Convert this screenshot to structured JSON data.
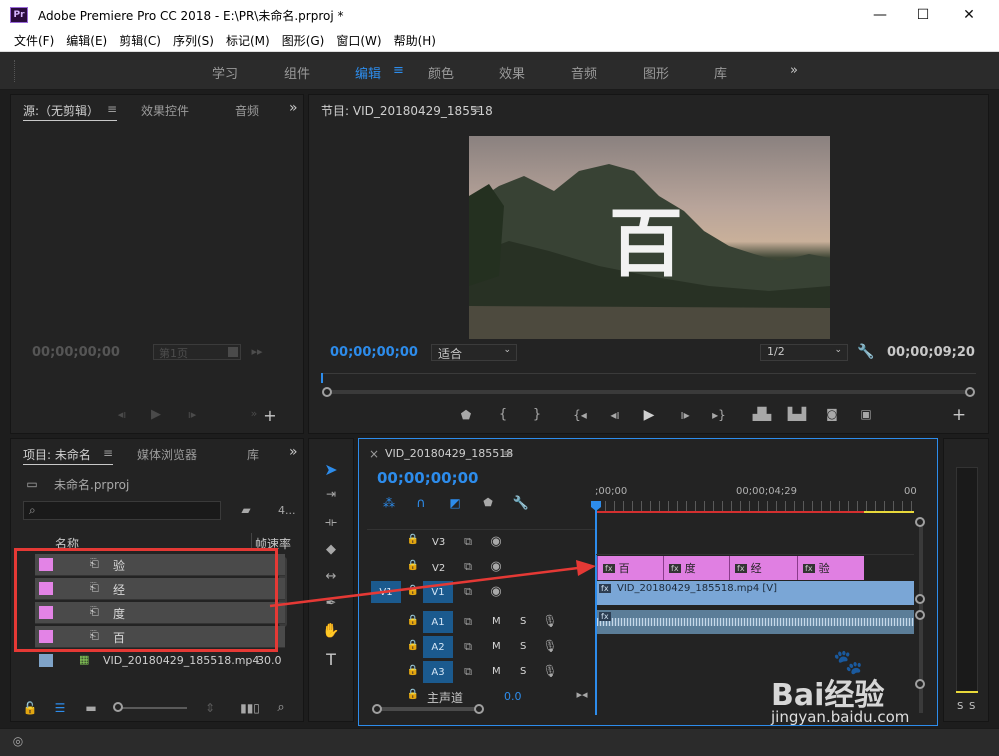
{
  "window": {
    "title": "Adobe Premiere Pro CC 2018 - E:\\PR\\未命名.prproj *",
    "app_icon": "Pr",
    "minimize": "—",
    "maximize": "☐",
    "close": "✕"
  },
  "menu": [
    "文件(F)",
    "编辑(E)",
    "剪辑(C)",
    "序列(S)",
    "标记(M)",
    "图形(G)",
    "窗口(W)",
    "帮助(H)"
  ],
  "workspaces": {
    "items": [
      "学习",
      "组件",
      "编辑",
      "颜色",
      "效果",
      "音频",
      "图形",
      "库"
    ],
    "active": "编辑",
    "overflow": "»",
    "menu_icon": "≡"
  },
  "source_panel": {
    "tabs": [
      "源:（无剪辑）",
      "效果控件",
      "音频"
    ],
    "menu_icon": "≡",
    "overflow": "»",
    "timecode": "00;00;00;00",
    "page_label": "第1页"
  },
  "program_panel": {
    "title": "节目: VID_20180429_185518",
    "menu_icon": "≡",
    "preview_text": "百",
    "timecode": "00;00;00;00",
    "fit": "适合",
    "resolution": "1/2",
    "duration": "00;00;09;20"
  },
  "project_panel": {
    "tabs": [
      "项目: 未命名",
      "媒体浏览器",
      "库"
    ],
    "menu_icon": "≡",
    "overflow": "»",
    "file": "未命名.prproj",
    "item_count": "4...",
    "columns": [
      "名称",
      "帧速率"
    ],
    "items": [
      {
        "name": "验",
        "color": "#e383e6"
      },
      {
        "name": "经",
        "color": "#e383e6"
      },
      {
        "name": "度",
        "color": "#e383e6"
      },
      {
        "name": "百",
        "color": "#e383e6"
      },
      {
        "name": "VID_20180429_185518.mp4",
        "color": "#7fa3c8",
        "fps": "30.0"
      }
    ]
  },
  "timeline": {
    "close": "×",
    "sequence": "VID_20180429_185518",
    "menu_icon": "≡",
    "timecode": "00;00;00;00",
    "ruler": [
      ";00;00",
      "00;00;04;29",
      "00"
    ],
    "video_tracks": [
      "V3",
      "V2",
      "V1"
    ],
    "audio_tracks": [
      "A1",
      "A2",
      "A3"
    ],
    "source_patch": "V1",
    "mute": "M",
    "solo": "S",
    "master": "主声道",
    "master_value": "0.0",
    "text_clips": [
      "百",
      "度",
      "经",
      "验"
    ],
    "video_clip": "VID_20180429_185518.mp4 [V]",
    "fx": "fx"
  },
  "meter": {
    "solo_left": "S",
    "solo_right": "S"
  },
  "watermark": {
    "brand": "Bai经验",
    "url": "jingyan.baidu.com"
  },
  "colors": {
    "accent": "#2d8ceb",
    "annotation": "#e53935",
    "text_clip": "#e07fe2",
    "video_clip": "#7aa6d6"
  }
}
